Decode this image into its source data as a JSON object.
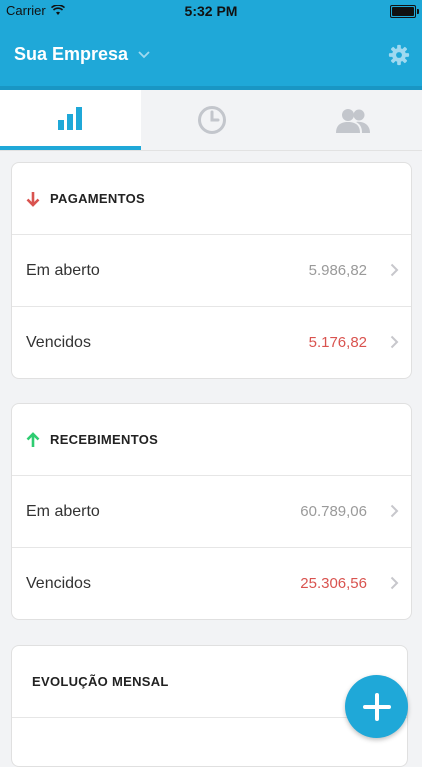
{
  "status_bar": {
    "carrier": "Carrier",
    "time": "5:32 PM"
  },
  "header": {
    "title": "Sua Empresa"
  },
  "tabs": [
    {
      "icon": "bar-chart-icon",
      "active": true
    },
    {
      "icon": "clock-icon",
      "active": false
    },
    {
      "icon": "users-icon",
      "active": false
    }
  ],
  "pagamentos": {
    "title": "PAGAMENTOS",
    "rows": [
      {
        "label": "Em aberto",
        "value": "5.986,82"
      },
      {
        "label": "Vencidos",
        "value": "5.176,82"
      }
    ]
  },
  "recebimentos": {
    "title": "RECEBIMENTOS",
    "rows": [
      {
        "label": "Em aberto",
        "value": "60.789,06"
      },
      {
        "label": "Vencidos",
        "value": "25.306,56"
      }
    ]
  },
  "evolucao": {
    "title": "EVOLUÇÃO MENSAL"
  },
  "colors": {
    "accent": "#1fa8d8",
    "red": "#d9534f",
    "green": "#2ecc71"
  }
}
